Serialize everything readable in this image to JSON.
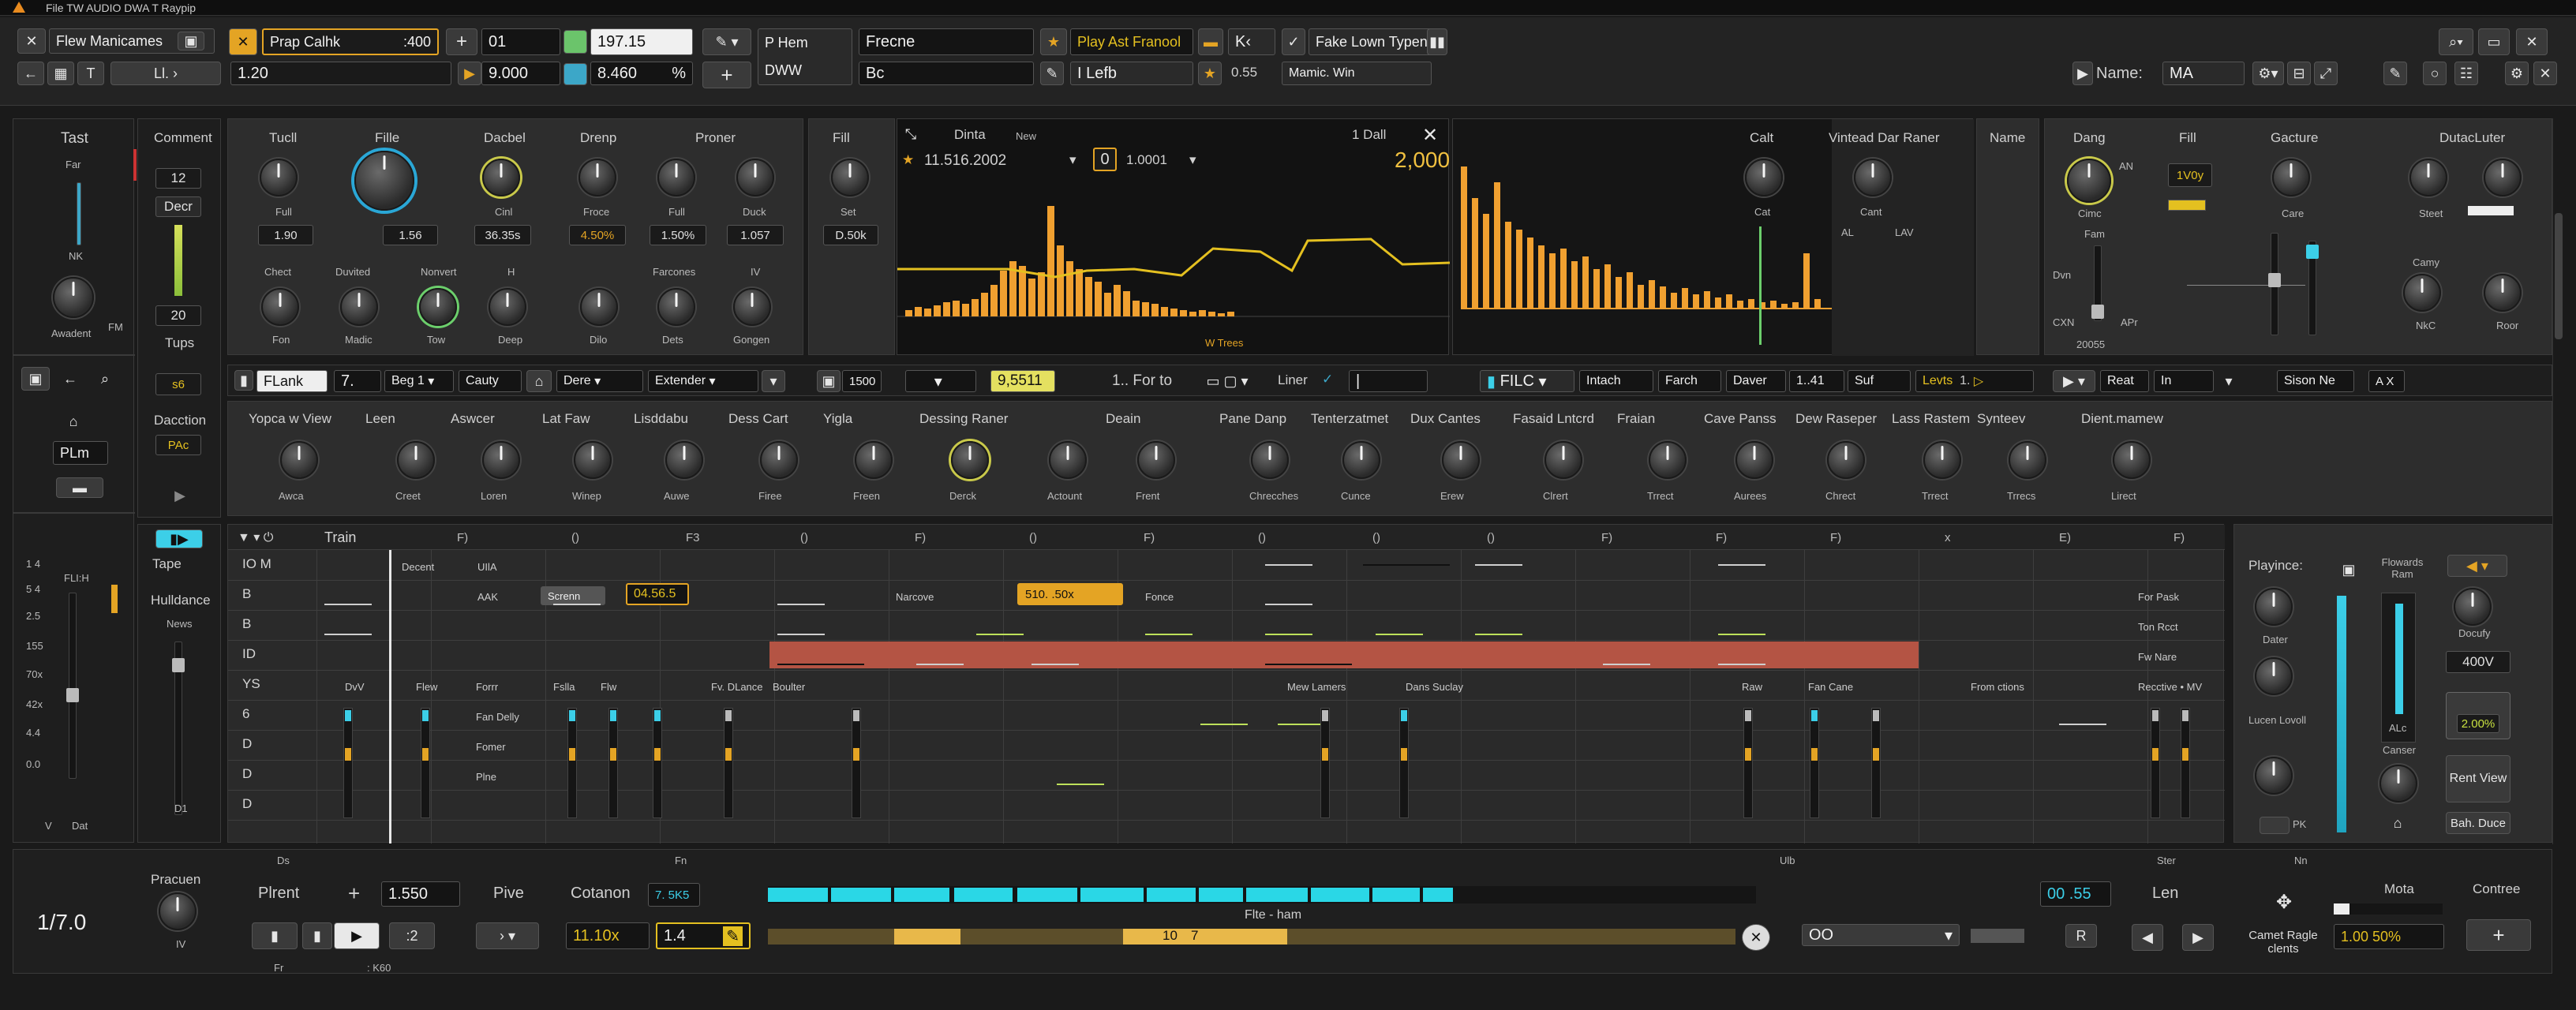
{
  "menubar": {
    "text": "File   TW  AUDIO DWA T Raypip"
  },
  "toolbar1": {
    "track": "Flew Manicames",
    "preset": "Prap Calhk",
    "preset_num": ":400",
    "counter": "01",
    "value_a": "197.15",
    "mode": "P Hem",
    "mode2": "DWW",
    "freq": "Frecne",
    "play_label": "Play Ast Franool",
    "k_label": "K",
    "fade": "Fake Lown Typen",
    "tempo": "1.20",
    "time": "9.000",
    "level": "8.460",
    "pct": "%",
    "bc": "Bc",
    "lefb": "I Lefb",
    "num055": "0.55",
    "mamic": "Mamic. Win",
    "name_label": "Name:",
    "name_value": "MA"
  },
  "left_strip": {
    "title": "Tast",
    "far": "Far",
    "nk": "NK",
    "awadent": "Awadent",
    "fm": "FM",
    "plm": "PLm",
    "flt": "FLI:H",
    "v": "V",
    "dat": "Dat",
    "ticks": [
      "1 4",
      "5 4",
      "2.5",
      "155",
      "70x",
      "42x",
      "4.4",
      "0.0"
    ]
  },
  "comment": {
    "title": "Comment",
    "num": "12",
    "decr": "Decr",
    "num2": "20",
    "tups": "Tups",
    "s6": "s6",
    "daction": "Dacction",
    "pac": "PAc"
  },
  "fx_top": {
    "labels": [
      "Tucll",
      "Fille",
      "Dacbel",
      "Drenp",
      "Proner"
    ],
    "knob_names": [
      "Full",
      "",
      "Cinl",
      "Froce",
      "Full",
      "Duck"
    ],
    "values": [
      "1.90",
      "1.56",
      "36.35s",
      "4.50%",
      "1.50%",
      "1.057"
    ],
    "labels2": [
      "Chect",
      "Duvited",
      "Nonvert",
      "H",
      "Farcones",
      "IV"
    ],
    "knob_names2": [
      "Fon",
      "Madic",
      "Tow",
      "Deep",
      "Dilo",
      "Dets",
      "Gongen"
    ]
  },
  "fill": {
    "title": "Fill",
    "set": "Set",
    "val": "D.50k"
  },
  "graph": {
    "title": "Dinta",
    "new": "New",
    "dall": "1 Dall",
    "time": "11.516.2002",
    "zero": "0",
    "hz": "1.0001",
    "big": "2,000",
    "legend": "W Trees"
  },
  "analyzer": {
    "calt": "Calt",
    "vintead": "Vintead Dar Raner",
    "cat": "Cat",
    "cant": "Cant",
    "al": "AL",
    "lav": "LAV",
    "name": "Name"
  },
  "right_top": {
    "dang": "Dang",
    "fill": "Fill",
    "gacture": "Gacture",
    "dutaclter": "DutacLuter",
    "an": "AN",
    "v": "1V0y",
    "cimc": "Cimc",
    "care": "Care",
    "steet": "Steet",
    "fam": "Fam",
    "dvn": "Dvn",
    "cxn": "CXN",
    "apr": "APr",
    "camy": "Camy",
    "nkc": "NkC",
    "roor": "Roor",
    "num": "20055"
  },
  "control_bar": {
    "flank": "FLank",
    "seven": "7.",
    "beg": "Beg",
    "one": "1",
    "cauty": "Cauty",
    "dere": "Dere",
    "extender": "Extender",
    "n1500": "1500",
    "val": "9,5511",
    "forto": "1.. For to",
    "liner": "Liner",
    "filc": "FILC",
    "intach": "Intach",
    "farch": "Farch",
    "daver": "Daver",
    "v141": "1..41",
    "suf": "Suf",
    "levts": "Levts",
    "t": "1.",
    "reat": "Reat",
    "in": "In",
    "sison": "Sison Ne",
    "ax": "A X"
  },
  "knob_row": [
    {
      "top": "Yopca w View",
      "bot": "Awca"
    },
    {
      "top": "Leen",
      "bot": "Creet"
    },
    {
      "top": "Aswcer",
      "bot": "Loren"
    },
    {
      "top": "Lat Faw",
      "bot": "Winep"
    },
    {
      "top": "Lisddabu",
      "bot": "Auwe"
    },
    {
      "top": "Dess Cart",
      "bot": "Firee"
    },
    {
      "top": "Yigla",
      "bot": "Freen"
    },
    {
      "top": "Dessing Raner",
      "bot": "Derck"
    },
    {
      "top": "",
      "bot": "Actount"
    },
    {
      "top": "Deain",
      "bot": "Frent"
    },
    {
      "top": "Pane Danp",
      "bot": "Chrecches"
    },
    {
      "top": "Tenterzatmet",
      "bot": "Cunce"
    },
    {
      "top": "Dux Cantes",
      "bot": "Erew"
    },
    {
      "top": "Fasaid Lntcrd",
      "bot": "Clrert"
    },
    {
      "top": "Fraian",
      "bot": "Trrect"
    },
    {
      "top": "Cave Panss",
      "bot": "Aurees"
    },
    {
      "top": "Dew Raseper",
      "bot": "Chrect"
    },
    {
      "top": "Lass Rastem",
      "bot": "Trrect"
    },
    {
      "top": "Synteev",
      "bot": "Trrecs"
    },
    {
      "top": "Dient.mamew",
      "bot": "Lirect"
    }
  ],
  "sequencer": {
    "train": "Train",
    "header_marks": [
      "F)",
      "()",
      "F3",
      "()",
      "F)",
      "()",
      "F)",
      "()",
      "()",
      "()",
      "F)",
      "F)",
      "F)",
      "x",
      "E)",
      "F)",
      "()"
    ],
    "rows": [
      "IO M",
      "B",
      "B",
      "ID",
      "YS",
      "6",
      "D",
      "D",
      "D"
    ],
    "decent": "Decent",
    "ulla": "UIlA",
    "aak": "AAK",
    "screen": "Screnn",
    "val1": "04.56.5",
    "narcove": "Narcove",
    "val2": "510. .50x",
    "fonce": "Fonce",
    "forpask": "For Pask",
    "tonrect": "Ton Rcct",
    "fwnare": "Fw Nare",
    "recctive": "Recctive • MV",
    "dw": "DvV",
    "flew": "Flew",
    "forr": "Forrr",
    "fslla": "Fslla",
    "flw": "Flw",
    "fvdlance": "Fv. DLance",
    "bouter": "Boulter",
    "mewlamers": "Mew Lamers",
    "dansfuclay": "Dans Suclay",
    "raw": "Raw",
    "faricane": "Fan Cane",
    "fromctions": "From ctions",
    "fandelly": "Fan Delly",
    "fomer": "Fomer",
    "plne": "Plne"
  },
  "tape": {
    "tape": "Tape",
    "hulldance": "Hulldance",
    "news": "News",
    "d1": "D1"
  },
  "right_panel": {
    "playince": "Playince:",
    "flowards": "Flowards Ram",
    "dater": "Dater",
    "lucen": "Lucen Lovoll",
    "canser": "Canser",
    "alc": "ALc",
    "docufy": "Docufy",
    "v400": "400V",
    "p200": "2.00%",
    "rent": "Rent View",
    "bahduce": "Bah. Duce",
    "pk": "PK"
  },
  "transport": {
    "pracuen": "Pracuen",
    "iv": "IV",
    "time": "1/7.0",
    "plrent": "Plrent",
    "plus": "+",
    "val": "1.550",
    "pive": "Pive",
    "cotanon": "Cotanon",
    "cval": "7. 5K5",
    "v1110": "11.10x",
    "v14": "1.4",
    "film": "Flte - ham",
    "ten": "10",
    "seven": "7",
    "time2": "00 .55",
    "len": "Len",
    "oo": "OO",
    "r": "R",
    "ds": "Ds",
    "fn": "Fn",
    "ulb": "Ulb",
    "ster": "Ster",
    "nn": "Nn",
    "camet": "Camet Ragle clents",
    "mota": "Mota",
    "mota_val": "1.00 50%",
    "contree": "Contree",
    "fr": "Fr",
    "k60": ": K60"
  }
}
